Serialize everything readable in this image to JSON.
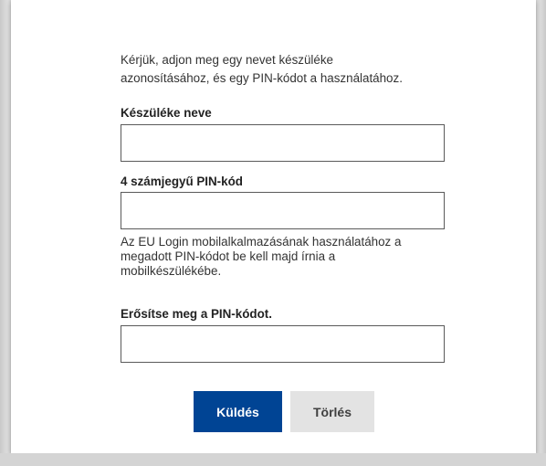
{
  "intro": {
    "line1": "Kérjük, adjon meg egy nevet készüléke",
    "line2": "azonosításához, és egy PIN-kódot a használatához."
  },
  "device_name": {
    "label": "Készüléke neve",
    "value": ""
  },
  "pin": {
    "label": "4 számjegyű PIN-kód",
    "value": "",
    "help_line1": "Az EU Login mobilalkalmazásának használatához a",
    "help_line2": "megadott PIN-kódot be kell majd írnia a",
    "help_line3": "mobilkészülékébe."
  },
  "pin_confirm": {
    "label": "Erősítse meg a PIN-kódot.",
    "value": ""
  },
  "buttons": {
    "submit": "Küldés",
    "clear": "Törlés"
  },
  "colors": {
    "primary": "#004494",
    "secondary": "#e3e3e3",
    "page_background": "#d2d2d2",
    "panel": "#ffffff"
  }
}
